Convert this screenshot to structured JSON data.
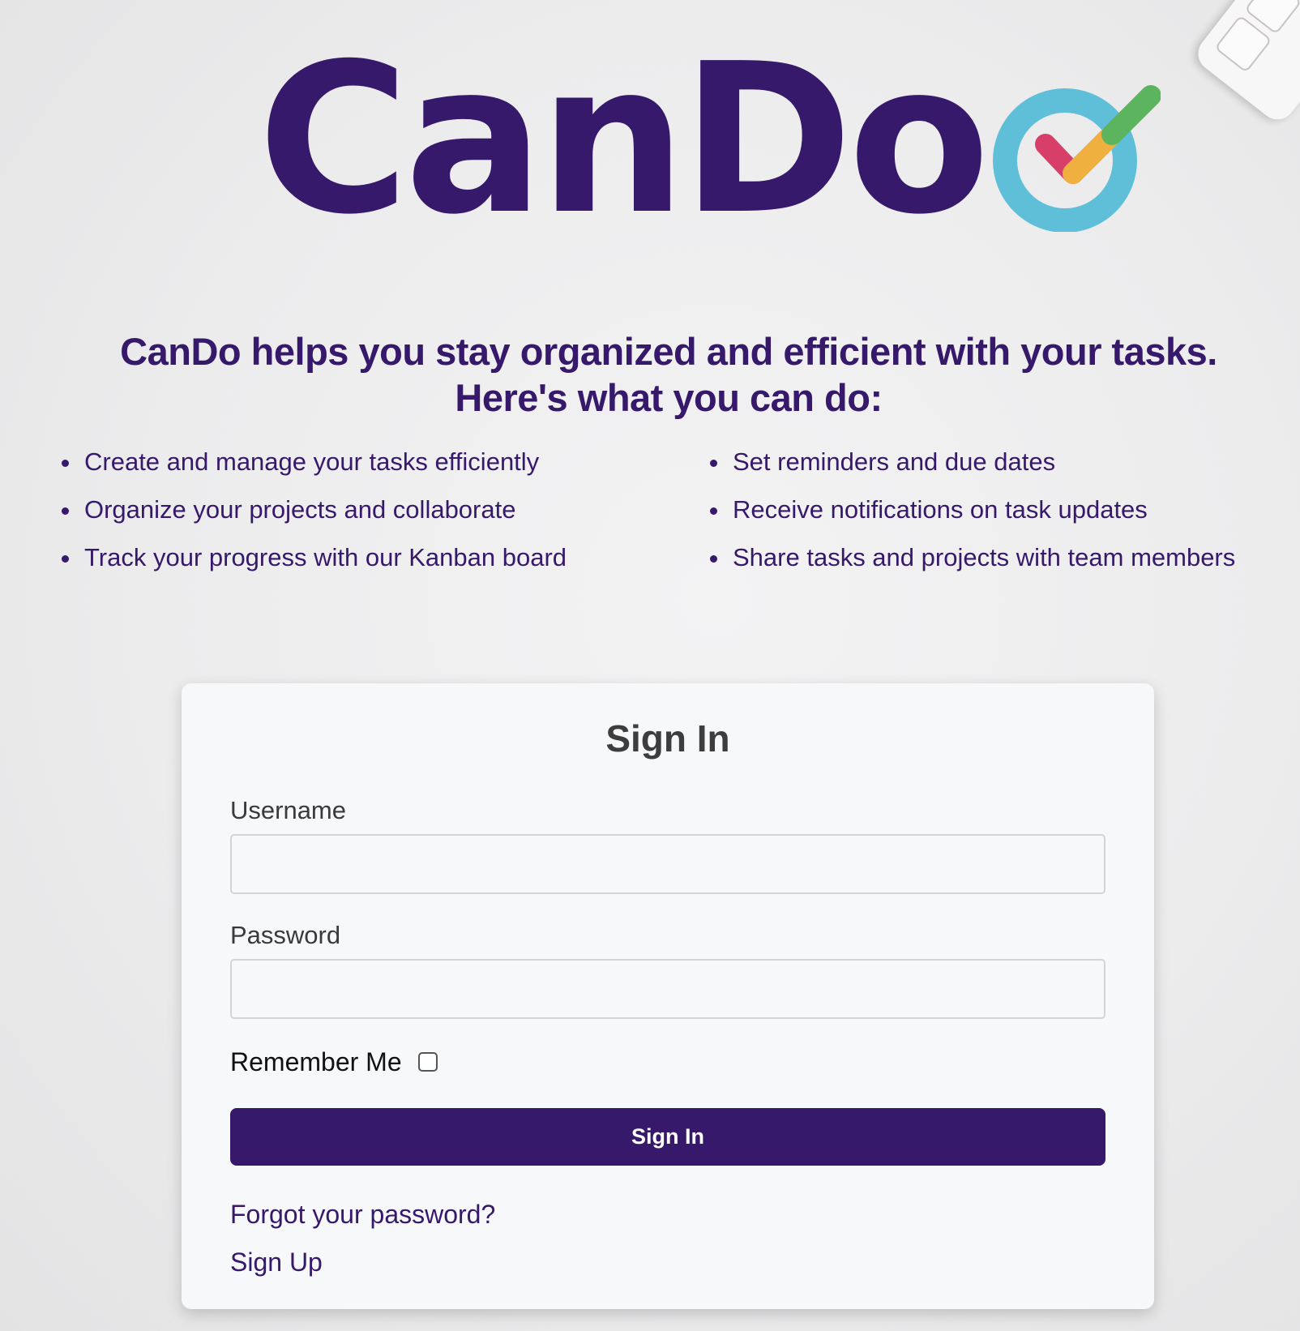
{
  "brand": {
    "name": "CanDo",
    "primary_color": "#36196a",
    "logo_check_colors": {
      "ring": "#5fbfd9",
      "check_red": "#d83f68",
      "check_orange": "#f0b040",
      "check_green": "#5cb55e"
    }
  },
  "intro": {
    "headline_line1": "CanDo helps you stay organized and efficient with your tasks.",
    "headline_line2": "Here's what you can do:"
  },
  "features": {
    "left": [
      "Create and manage your tasks efficiently",
      "Organize your projects and collaborate",
      "Track your progress with our Kanban board"
    ],
    "right": [
      "Set reminders and due dates",
      "Receive notifications on task updates",
      "Share tasks and projects with team members"
    ]
  },
  "signin_form": {
    "title": "Sign In",
    "username_label": "Username",
    "username_value": "",
    "password_label": "Password",
    "password_value": "",
    "remember_label": "Remember Me",
    "remember_checked": false,
    "submit_label": "Sign In",
    "forgot_link": "Forgot your password?",
    "signup_link": "Sign Up"
  }
}
